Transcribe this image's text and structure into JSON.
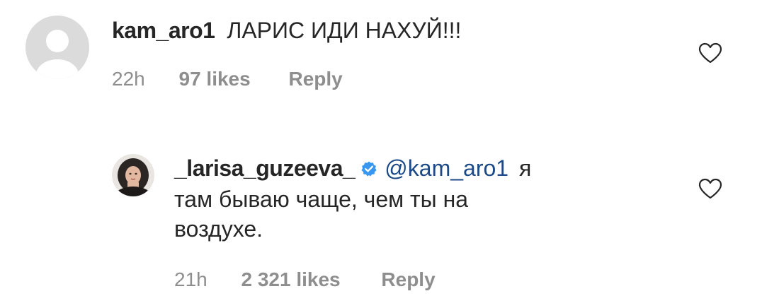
{
  "comments": [
    {
      "username": "kam_aro1",
      "text": "ЛАРИС ИДИ НАХУЙ!!!",
      "time": "22h",
      "likes": "97 likes",
      "reply": "Reply",
      "avatar": "default-avatar-icon"
    },
    {
      "username": "_larisa_guzeeva_",
      "verified": true,
      "mention": "@kam_aro1",
      "text_line1": "я",
      "text_line2": "там бываю чаще, чем ты на",
      "text_line3": "воздухе.",
      "time": "21h",
      "likes": "2 321 likes",
      "reply": "Reply",
      "avatar": "profile-photo"
    }
  ],
  "colors": {
    "text": "#262626",
    "meta": "#8e8e8e",
    "mention": "#1c4a86",
    "verified": "#3897f0",
    "avatar_bg": "#dbdbdb"
  }
}
